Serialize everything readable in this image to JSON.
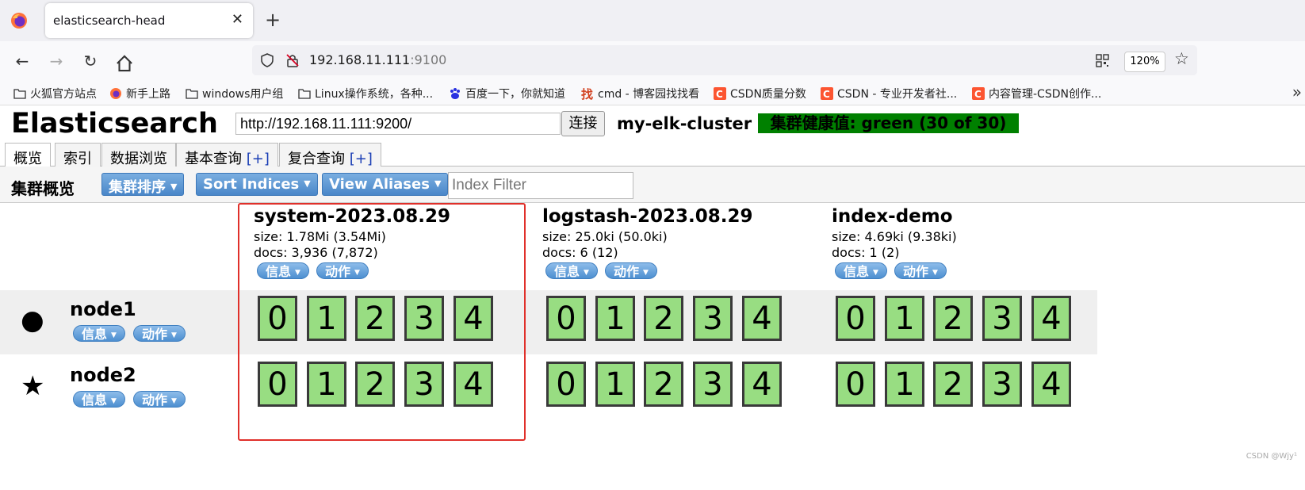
{
  "browser": {
    "tab_title": "elasticsearch-head",
    "tab_close": "✕",
    "new_tab": "+",
    "url_host": "192.168.11.111",
    "url_port": ":9100",
    "zoom": "120%",
    "bookmarks": [
      {
        "label": "火狐官方站点",
        "icon": "folder-icon"
      },
      {
        "label": "新手上路",
        "icon": "firefox-icon"
      },
      {
        "label": "windows用户组",
        "icon": "folder-icon"
      },
      {
        "label": "Linux操作系统，各种...",
        "icon": "folder-icon"
      },
      {
        "label": "百度一下，你就知道",
        "icon": "baidu-icon"
      },
      {
        "label": "cmd - 博客园找找看",
        "icon": "cnblogs-icon"
      },
      {
        "label": "CSDN质量分数",
        "icon": "csdn-icon"
      },
      {
        "label": "CSDN - 专业开发者社...",
        "icon": "csdn-icon"
      },
      {
        "label": "内容管理-CSDN创作...",
        "icon": "csdn-icon"
      }
    ],
    "bookmarks_more": "»"
  },
  "app": {
    "title": "Elasticsearch",
    "connect_url": "http://192.168.11.111:9200/",
    "connect_button": "连接",
    "cluster_name": "my-elk-cluster",
    "health": "集群健康值: green (30 of 30)",
    "health_color": "#008000",
    "tabs": [
      {
        "label": "概览",
        "plus": ""
      },
      {
        "label": "索引",
        "plus": ""
      },
      {
        "label": "数据浏览",
        "plus": ""
      },
      {
        "label": "基本查询 ",
        "plus": "[+]"
      },
      {
        "label": "复合查询 ",
        "plus": "[+]"
      }
    ]
  },
  "toolbar": {
    "title": "集群概览",
    "cluster_sort": "集群排序",
    "sort_indices": "Sort Indices",
    "view_aliases": "View Aliases",
    "index_filter_placeholder": "Index Filter"
  },
  "indices": [
    {
      "name": "system-2023.08.29",
      "size": "size: 1.78Mi (3.54Mi)",
      "docs": "docs: 3,936 (7,872)",
      "info": "信息",
      "action": "动作"
    },
    {
      "name": "logstash-2023.08.29",
      "size": "size: 25.0ki (50.0ki)",
      "docs": "docs: 6 (12)",
      "info": "信息",
      "action": "动作"
    },
    {
      "name": "index-demo",
      "size": "size: 4.69ki (9.38ki)",
      "docs": "docs: 1 (2)",
      "info": "信息",
      "action": "动作"
    }
  ],
  "nodes": [
    {
      "name": "node1",
      "icon": "●",
      "icon_name": "master-node-circle-icon",
      "info": "信息",
      "action": "动作"
    },
    {
      "name": "node2",
      "icon": "★",
      "icon_name": "master-eligible-star-icon",
      "info": "信息",
      "action": "动作"
    }
  ],
  "shards": [
    "0",
    "1",
    "2",
    "3",
    "4"
  ],
  "shard_color": "#98dd82",
  "highlight_color": "#e0302a",
  "watermark": "CSDN @Wjy¹"
}
